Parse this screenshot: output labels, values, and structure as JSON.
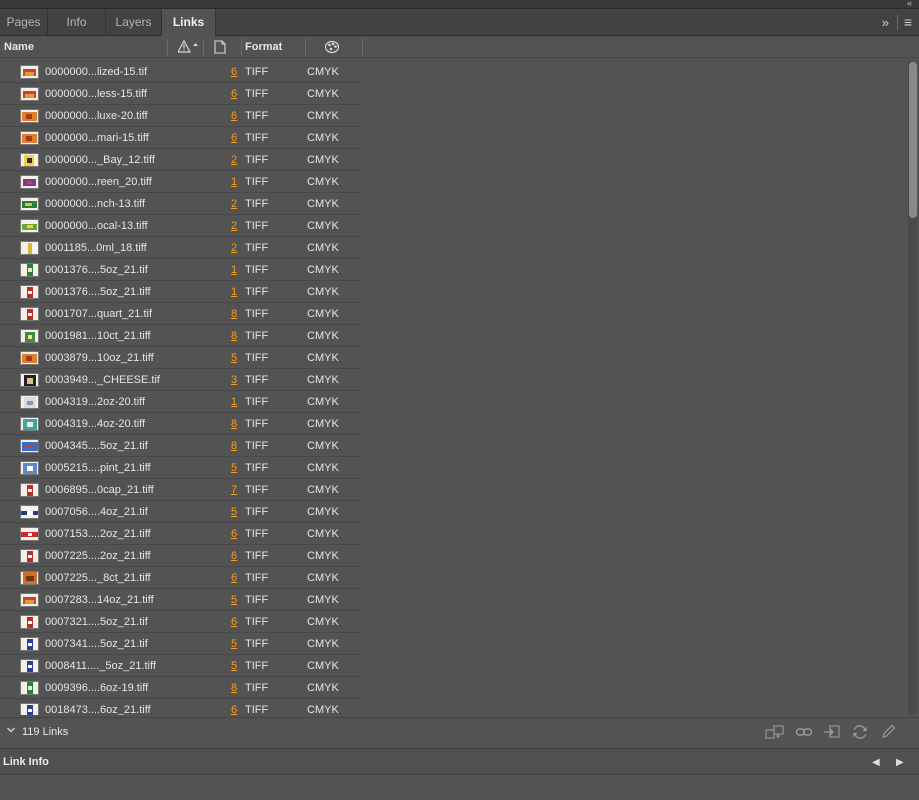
{
  "panel": {
    "collapse_glyph": "«",
    "tabs": [
      {
        "label": "Pages",
        "active": false
      },
      {
        "label": "Info",
        "active": false
      },
      {
        "label": "Layers",
        "active": false
      },
      {
        "label": "Links",
        "active": true
      }
    ],
    "overflow_glyph": "»",
    "menu_glyph": "≡"
  },
  "columns": {
    "name": "Name",
    "status_icon": "warning-icon",
    "page_icon": "page-icon",
    "format": "Format",
    "color_icon": "color-space-icon"
  },
  "rows": [
    {
      "name": "0000000...lized-15.tif",
      "page": "6",
      "format": "TIFF",
      "color": "CMYK",
      "thumb": "thumb-red-orange"
    },
    {
      "name": "0000000...less-15.tiff",
      "page": "6",
      "format": "TIFF",
      "color": "CMYK",
      "thumb": "thumb-red-orange"
    },
    {
      "name": "0000000...luxe-20.tiff",
      "page": "6",
      "format": "TIFF",
      "color": "CMYK",
      "thumb": "thumb-orange"
    },
    {
      "name": "0000000...mari-15.tiff",
      "page": "6",
      "format": "TIFF",
      "color": "CMYK",
      "thumb": "thumb-orange"
    },
    {
      "name": "0000000..._Bay_12.tiff",
      "page": "2",
      "format": "TIFF",
      "color": "CMYK",
      "thumb": "thumb-yellow"
    },
    {
      "name": "0000000...reen_20.tiff",
      "page": "1",
      "format": "TIFF",
      "color": "CMYK",
      "thumb": "thumb-purple"
    },
    {
      "name": "0000000...nch-13.tiff",
      "page": "2",
      "format": "TIFF",
      "color": "CMYK",
      "thumb": "thumb-green"
    },
    {
      "name": "0000000...ocal-13.tiff",
      "page": "2",
      "format": "TIFF",
      "color": "CMYK",
      "thumb": "thumb-green-yellow"
    },
    {
      "name": "0001185...0ml_18.tiff",
      "page": "2",
      "format": "TIFF",
      "color": "CMYK",
      "thumb": "thumb-bottle-yellow"
    },
    {
      "name": "0001376....5oz_21.tif",
      "page": "1",
      "format": "TIFF",
      "color": "CMYK",
      "thumb": "thumb-bottle-green"
    },
    {
      "name": "0001376....5oz_21.tiff",
      "page": "1",
      "format": "TIFF",
      "color": "CMYK",
      "thumb": "thumb-bottle-red"
    },
    {
      "name": "0001707...quart_21.tif",
      "page": "8",
      "format": "TIFF",
      "color": "CMYK",
      "thumb": "thumb-bottle-red"
    },
    {
      "name": "0001981...10ct_21.tiff",
      "page": "8",
      "format": "TIFF",
      "color": "CMYK",
      "thumb": "thumb-green-circle"
    },
    {
      "name": "0003879...10oz_21.tiff",
      "page": "5",
      "format": "TIFF",
      "color": "CMYK",
      "thumb": "thumb-orange"
    },
    {
      "name": "0003949..._CHEESE.tif",
      "page": "3",
      "format": "TIFF",
      "color": "CMYK",
      "thumb": "thumb-dark-circle"
    },
    {
      "name": "0004319...2oz-20.tiff",
      "page": "1",
      "format": "TIFF",
      "color": "CMYK",
      "thumb": "thumb-white"
    },
    {
      "name": "0004319...4oz-20.tiff",
      "page": "8",
      "format": "TIFF",
      "color": "CMYK",
      "thumb": "thumb-teal"
    },
    {
      "name": "0004345....5oz_21.tif",
      "page": "8",
      "format": "TIFF",
      "color": "CMYK",
      "thumb": "thumb-blue-red"
    },
    {
      "name": "0005215....pint_21.tiff",
      "page": "5",
      "format": "TIFF",
      "color": "CMYK",
      "thumb": "thumb-blue-white"
    },
    {
      "name": "0006895...0cap_21.tiff",
      "page": "7",
      "format": "TIFF",
      "color": "CMYK",
      "thumb": "thumb-bottle-red"
    },
    {
      "name": "0007056....4oz_21.tif",
      "page": "5",
      "format": "TIFF",
      "color": "CMYK",
      "thumb": "thumb-blue-strip"
    },
    {
      "name": "0007153....2oz_21.tiff",
      "page": "6",
      "format": "TIFF",
      "color": "CMYK",
      "thumb": "thumb-red-strip"
    },
    {
      "name": "0007225....2oz_21.tiff",
      "page": "6",
      "format": "TIFF",
      "color": "CMYK",
      "thumb": "thumb-bottle-red"
    },
    {
      "name": "0007225..._8ct_21.tiff",
      "page": "6",
      "format": "TIFF",
      "color": "CMYK",
      "thumb": "thumb-orange-box"
    },
    {
      "name": "0007283...14oz_21.tiff",
      "page": "5",
      "format": "TIFF",
      "color": "CMYK",
      "thumb": "thumb-red-orange"
    },
    {
      "name": "0007321....5oz_21.tif",
      "page": "6",
      "format": "TIFF",
      "color": "CMYK",
      "thumb": "thumb-bottle-red"
    },
    {
      "name": "0007341....5oz_21.tif",
      "page": "5",
      "format": "TIFF",
      "color": "CMYK",
      "thumb": "thumb-bottle-blue"
    },
    {
      "name": "0008411...._5oz_21.tiff",
      "page": "5",
      "format": "TIFF",
      "color": "CMYK",
      "thumb": "thumb-bottle-blue"
    },
    {
      "name": "0009396....6oz-19.tiff",
      "page": "8",
      "format": "TIFF",
      "color": "CMYK",
      "thumb": "thumb-bottle-green"
    },
    {
      "name": "0018473....6oz_21.tiff",
      "page": "6",
      "format": "TIFF",
      "color": "CMYK",
      "thumb": "thumb-bottle-blue"
    }
  ],
  "status": {
    "count_label": "119 Links",
    "buttons": [
      "relink-from-cc-icon",
      "link-icon",
      "go-to-link-icon",
      "update-link-icon",
      "edit-original-icon"
    ]
  },
  "link_info": {
    "title": "Link Info",
    "prev": "◀",
    "next": "▶"
  },
  "colors": {
    "accent_page_link": "#f3a01c",
    "panel_bg": "#535353"
  }
}
